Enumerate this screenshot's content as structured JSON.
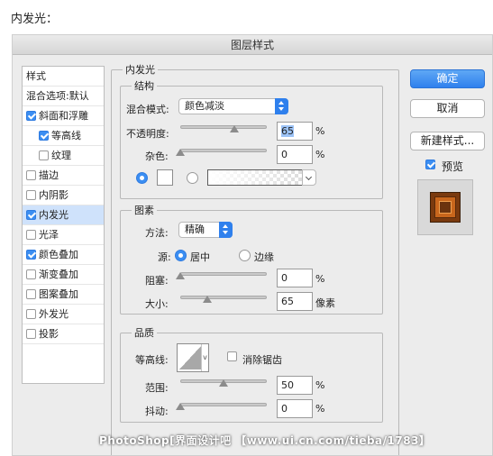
{
  "caption": "内发光：",
  "dialog": {
    "title": "图层样式",
    "sidebar": {
      "header": "样式",
      "blend_options": "混合选项:默认",
      "items": [
        {
          "label": "斜面和浮雕",
          "checked": true
        },
        {
          "label": "等高线",
          "checked": true
        },
        {
          "label": "纹理",
          "checked": false
        },
        {
          "label": "描边",
          "checked": false
        },
        {
          "label": "内阴影",
          "checked": false
        },
        {
          "label": "内发光",
          "checked": true,
          "selected": true
        },
        {
          "label": "光泽",
          "checked": false
        },
        {
          "label": "颜色叠加",
          "checked": true
        },
        {
          "label": "渐变叠加",
          "checked": false
        },
        {
          "label": "图案叠加",
          "checked": false
        },
        {
          "label": "外发光",
          "checked": false
        },
        {
          "label": "投影",
          "checked": false
        }
      ]
    },
    "panel_title": "内发光",
    "structure": {
      "legend": "结构",
      "blend_mode_label": "混合模式:",
      "blend_mode_value": "颜色减淡",
      "opacity_label": "不透明度:",
      "opacity_value": "65",
      "opacity_unit": "%",
      "noise_label": "杂色:",
      "noise_value": "0",
      "noise_unit": "%",
      "glow_type": "color",
      "glow_color": "#ffffff"
    },
    "elements": {
      "legend": "图素",
      "method_label": "方法:",
      "method_value": "精确",
      "source_label": "源:",
      "source_center": "居中",
      "source_edge": "边缘",
      "source_selected": "center",
      "choke_label": "阻塞:",
      "choke_value": "0",
      "choke_unit": "%",
      "size_label": "大小:",
      "size_value": "65",
      "size_unit": "像素"
    },
    "quality": {
      "legend": "品质",
      "contour_label": "等高线:",
      "antialias_label": "消除锯齿",
      "antialias_checked": false,
      "range_label": "范围:",
      "range_value": "50",
      "range_unit": "%",
      "jitter_label": "抖动:",
      "jitter_value": "0",
      "jitter_unit": "%"
    },
    "buttons": {
      "ok": "确定",
      "cancel": "取消",
      "new_style": "新建样式...",
      "preview_label": "预览",
      "preview_checked": true
    },
    "accent_color": "#2f80ed"
  },
  "watermark": "PhotoShop[界面设计吧 【www.ui.cn.com/tieba/1783】"
}
